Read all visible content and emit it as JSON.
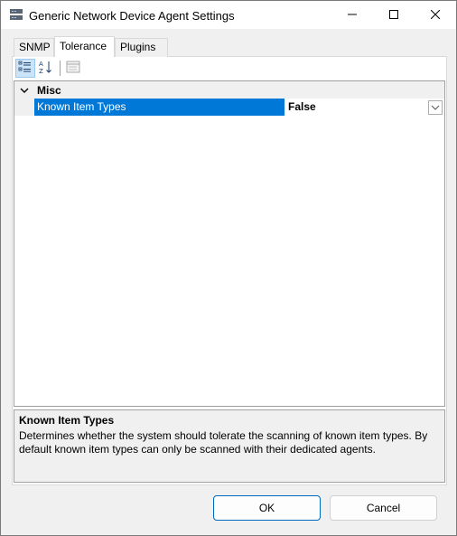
{
  "window": {
    "title": "Generic Network Device Agent Settings",
    "icons": {
      "app": "network-device-icon",
      "minimize": "minimize-icon",
      "maximize": "maximize-icon",
      "close": "close-icon"
    }
  },
  "tabs": [
    {
      "label": "SNMP",
      "selected": false
    },
    {
      "label": "Tolerance",
      "selected": true
    },
    {
      "label": "Plugins",
      "selected": false
    }
  ],
  "toolbar": {
    "buttons": [
      {
        "name": "categorized",
        "icon": "categorized-view-icon",
        "active": true
      },
      {
        "name": "alphabetical",
        "icon": "sort-alphabetical-icon",
        "active": false
      },
      {
        "name": "property-pages",
        "icon": "property-pages-icon",
        "active": false
      }
    ]
  },
  "grid": {
    "category": {
      "label": "Misc",
      "expanded": true
    },
    "properties": [
      {
        "name": "Known Item Types",
        "value": "False",
        "selected": true
      }
    ]
  },
  "description": {
    "title": "Known Item Types",
    "text": "Determines whether the system should tolerate the scanning of known item types. By default known item types can only be scanned with their dedicated agents."
  },
  "buttons": {
    "ok": "OK",
    "cancel": "Cancel"
  },
  "colors": {
    "selection": "#0078d7",
    "window_bg": "#f0f0f0",
    "default_button_border": "#0067c0"
  }
}
